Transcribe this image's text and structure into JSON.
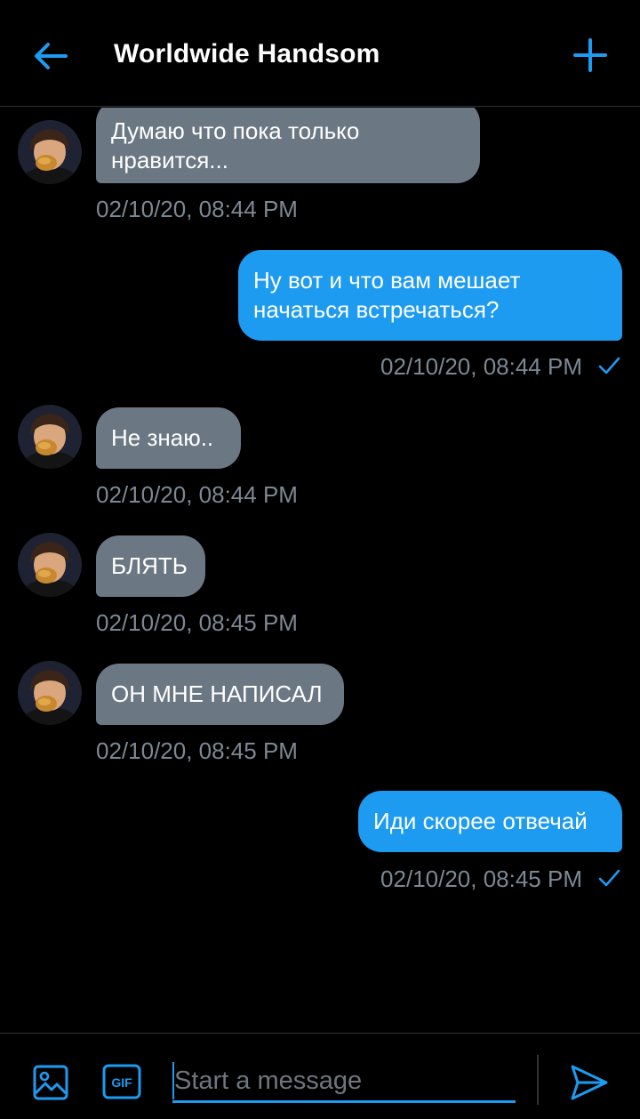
{
  "header": {
    "title": "Worldwide Handsom",
    "back_icon": "arrow-left-icon",
    "new_icon": "plus-icon"
  },
  "messages": [
    {
      "direction": "in",
      "text_lines": [
        "Думаю что пока только",
        "нравится..."
      ],
      "timestamp": "02/10/20, 08:44 PM"
    },
    {
      "direction": "out",
      "text_lines": [
        "Ну вот и что вам мешает",
        "начаться встречаться?"
      ],
      "timestamp": "02/10/20, 08:44 PM",
      "read": true
    },
    {
      "direction": "in",
      "text_lines": [
        "Не знаю.."
      ],
      "timestamp": "02/10/20, 08:44 PM"
    },
    {
      "direction": "in",
      "text_lines": [
        "БЛЯТЬ"
      ],
      "timestamp": "02/10/20, 08:45 PM"
    },
    {
      "direction": "in",
      "text_lines": [
        "ОН МНЕ НАПИСАЛ"
      ],
      "timestamp": "02/10/20, 08:45 PM"
    },
    {
      "direction": "out",
      "text_lines": [
        "Иди скорее отвечай"
      ],
      "timestamp": "02/10/20, 08:45 PM",
      "read": true
    }
  ],
  "composer": {
    "placeholder": "Start a message",
    "value": "",
    "gif_label": "GIF",
    "image_icon": "image-icon",
    "send_icon": "send-icon"
  },
  "colors": {
    "background": "#000000",
    "accent": "#1d9bf0",
    "incoming_bubble": "#6b7884",
    "timestamp": "#7c8893",
    "border": "#2f3336"
  }
}
